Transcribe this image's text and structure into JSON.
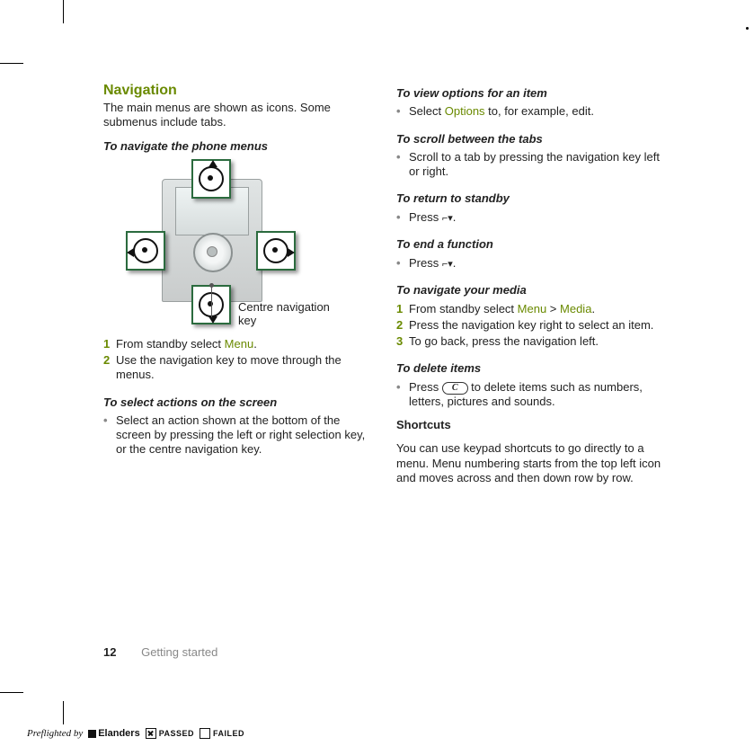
{
  "left": {
    "heading": "Navigation",
    "intro": "The main menus are shown as icons. Some submenus include tabs.",
    "sub1": "To navigate the phone menus",
    "diagram_label": "Centre navigation key",
    "step1_pre": "From standby select ",
    "step1_link": "Menu",
    "step1_post": ".",
    "step2": "Use the navigation key to move through the menus.",
    "sub2": "To select actions on the screen",
    "bullet2": "Select an action shown at the bottom of the screen by pressing the left or right selection key, or the centre navigation key."
  },
  "right": {
    "sub1": "To view options for an item",
    "b1_pre": "Select ",
    "b1_link": "Options",
    "b1_post": " to, for example, edit.",
    "sub2": "To scroll between the tabs",
    "b2": "Scroll to a tab by pressing the navigation key left or right.",
    "sub3": "To return to standby",
    "b3_pre": "Press ",
    "b3_post": ".",
    "sub4": "To end a function",
    "b4_pre": "Press ",
    "b4_post": ".",
    "sub5": "To navigate your media",
    "n1_pre": "From standby select ",
    "n1_link1": "Menu",
    "n1_mid": " > ",
    "n1_link2": "Media",
    "n1_post": ".",
    "n2": "Press the navigation key right to select an item.",
    "n3": "To go back, press the navigation left.",
    "sub6": "To delete items",
    "b6_pre": "Press ",
    "b6_key": "C",
    "b6_post": " to delete items such as numbers, letters, pictures and sounds.",
    "sub7": "Shortcuts",
    "p7": "You can use keypad shortcuts to go directly to a menu. Menu numbering starts from the top left icon and moves across and then down row by row."
  },
  "markers": {
    "one": "1",
    "two": "2",
    "three": "3",
    "dot": "•"
  },
  "footer": {
    "page": "12",
    "section": "Getting started"
  },
  "preflight": {
    "label": "Preflighted by",
    "brand": "Elanders",
    "passed": "PASSED",
    "failed": "FAILED"
  }
}
